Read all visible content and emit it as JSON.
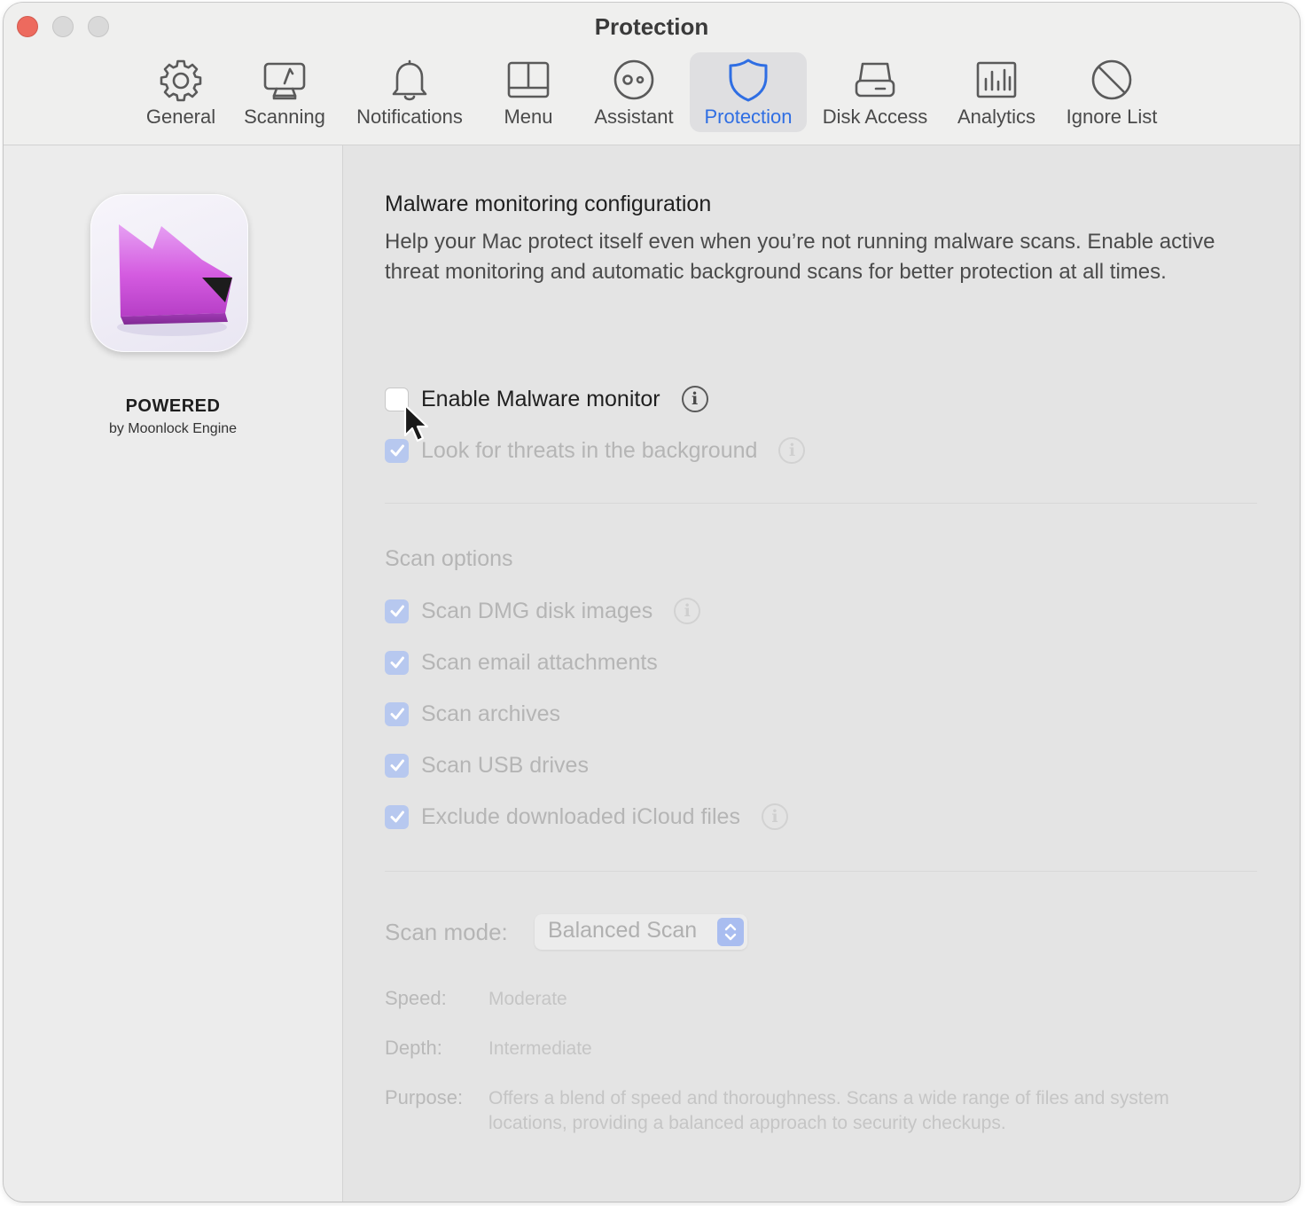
{
  "window": {
    "title": "Protection"
  },
  "tabs": [
    {
      "label": "General",
      "icon": "gear-icon",
      "active": false
    },
    {
      "label": "Scanning",
      "icon": "scanning-display-icon",
      "active": false
    },
    {
      "label": "Notifications",
      "icon": "bell-icon",
      "active": false
    },
    {
      "label": "Menu",
      "icon": "menu-window-icon",
      "active": false
    },
    {
      "label": "Assistant",
      "icon": "assistant-face-icon",
      "active": false
    },
    {
      "label": "Protection",
      "icon": "shield-icon",
      "active": true
    },
    {
      "label": "Disk Access",
      "icon": "disk-drive-icon",
      "active": false
    },
    {
      "label": "Analytics",
      "icon": "bar-chart-icon",
      "active": false
    },
    {
      "label": "Ignore List",
      "icon": "prohibited-icon",
      "active": false
    }
  ],
  "sidebar": {
    "app_icon": "moonlock-app-icon",
    "powered": "POWERED",
    "byline": "by Moonlock Engine"
  },
  "main": {
    "title": "Malware monitoring configuration",
    "description": "Help your Mac protect itself even when you’re not running malware scans. Enable active threat monitoring and automatic background scans for better protection at all times.",
    "monitor": {
      "label": "Enable Malware monitor",
      "checked": false,
      "enabled": true,
      "info": "i"
    },
    "background": {
      "label": "Look for threats in the background",
      "checked": true,
      "enabled": false,
      "info": "i"
    },
    "scan_options": {
      "heading": "Scan options",
      "items": [
        {
          "label": "Scan DMG disk images",
          "checked": true,
          "info": "i"
        },
        {
          "label": "Scan email attachments",
          "checked": true
        },
        {
          "label": "Scan archives",
          "checked": true
        },
        {
          "label": "Scan USB drives",
          "checked": true
        },
        {
          "label": "Exclude downloaded iCloud files",
          "checked": true,
          "info": "i"
        }
      ]
    },
    "scan_mode": {
      "label": "Scan mode:",
      "value": "Balanced Scan",
      "speed_label": "Speed:",
      "speed": "Moderate",
      "depth_label": "Depth:",
      "depth": "Intermediate",
      "purpose_label": "Purpose:",
      "purpose": "Offers a blend of speed and thoroughness. Scans a wide range of files and system locations, providing a balanced approach to security checkups."
    }
  },
  "colors": {
    "accent": "#2f6ee3",
    "checkbox_disabled": "#b7c8ef",
    "close_button": "#ed6a5e",
    "app_icon_pink": "#d45be0"
  }
}
